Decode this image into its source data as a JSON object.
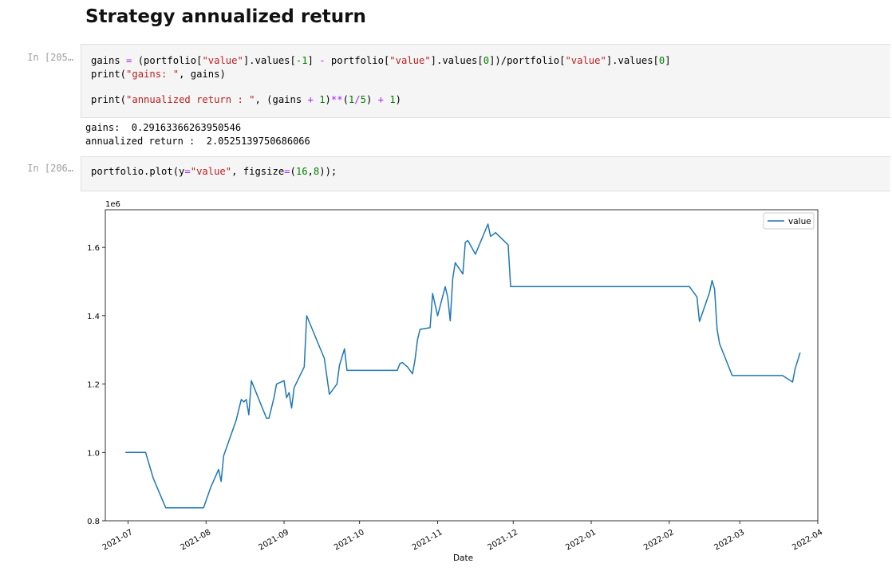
{
  "heading": "Strategy annualized return",
  "cells": [
    {
      "prompt": "In [205…",
      "lines": [
        [
          [
            "gains ",
            ""
          ],
          [
            "=",
            "op"
          ],
          [
            " (portfolio[",
            ""
          ],
          [
            "\"value\"",
            "str"
          ],
          [
            "].values[",
            ""
          ],
          [
            "-1",
            "num"
          ],
          [
            "] ",
            ""
          ],
          [
            "-",
            "op"
          ],
          [
            " portfolio[",
            ""
          ],
          [
            "\"value\"",
            "str"
          ],
          [
            "].values[",
            ""
          ],
          [
            "0",
            "num"
          ],
          [
            "])/portfolio[",
            ""
          ],
          [
            "\"value\"",
            "str"
          ],
          [
            "].values[",
            ""
          ],
          [
            "0",
            "num"
          ],
          [
            "]",
            ""
          ]
        ],
        [
          [
            "print(",
            ""
          ],
          [
            "\"gains: \"",
            "str"
          ],
          [
            ", gains)",
            ""
          ]
        ],
        [],
        [
          [
            "print(",
            ""
          ],
          [
            "\"annualized return : \"",
            "str"
          ],
          [
            ", (gains ",
            ""
          ],
          [
            "+",
            "op"
          ],
          [
            " ",
            ""
          ],
          [
            "1",
            "num"
          ],
          [
            ")",
            ""
          ],
          [
            "**",
            "op"
          ],
          [
            "(",
            ""
          ],
          [
            "1",
            "num"
          ],
          [
            "/",
            "op"
          ],
          [
            "5",
            "num"
          ],
          [
            ") ",
            ""
          ],
          [
            "+",
            "op"
          ],
          [
            " ",
            ""
          ],
          [
            "1",
            "num"
          ],
          [
            ")",
            ""
          ]
        ]
      ],
      "outputs": [
        "gains:  0.29163366263950546",
        "annualized return :  2.0525139750686066"
      ]
    },
    {
      "prompt": "In [206…",
      "lines": [
        [
          [
            "portfolio.plot(y",
            ""
          ],
          [
            "=",
            "op"
          ],
          [
            "\"value\"",
            "str"
          ],
          [
            ", figsize",
            ""
          ],
          [
            "=",
            "op"
          ],
          [
            "(",
            ""
          ],
          [
            "16",
            "num"
          ],
          [
            ",",
            ""
          ],
          [
            "8",
            "num"
          ],
          [
            "));",
            ""
          ]
        ]
      ],
      "outputs": []
    }
  ],
  "chart_data": {
    "type": "line",
    "xlabel": "Date",
    "ylabel": "",
    "scale_label": "1e6",
    "ylim": [
      0.8,
      1.71
    ],
    "xlim": [
      "2021-06-22",
      "2022-04-01"
    ],
    "yticks": [
      0.8,
      1.0,
      1.2,
      1.4,
      1.6
    ],
    "ytick_labels": [
      "0.8",
      "1.0",
      "1.2",
      "1.4",
      "1.6"
    ],
    "xticks": [
      "2021-07-01",
      "2021-08-01",
      "2021-09-01",
      "2021-10-01",
      "2021-11-01",
      "2021-12-01",
      "2022-01-01",
      "2022-02-01",
      "2022-03-01",
      "2022-04-01"
    ],
    "xtick_labels": [
      "2021-07",
      "2021-08",
      "2021-09",
      "2021-10",
      "2021-11",
      "2021-12",
      "2022-01",
      "2022-02",
      "2022-03",
      "2022-04"
    ],
    "legend_position": "upper right",
    "grid": false,
    "series": [
      {
        "name": "value",
        "color": "#1f77b4",
        "points": [
          [
            "2021-06-30",
            1.0
          ],
          [
            "2021-07-08",
            1.0
          ],
          [
            "2021-07-11",
            0.925
          ],
          [
            "2021-07-16",
            0.838
          ],
          [
            "2021-07-31",
            0.838
          ],
          [
            "2021-08-03",
            0.9
          ],
          [
            "2021-08-06",
            0.95
          ],
          [
            "2021-08-07",
            0.915
          ],
          [
            "2021-08-08",
            0.99
          ],
          [
            "2021-08-13",
            1.095
          ],
          [
            "2021-08-15",
            1.155
          ],
          [
            "2021-08-16",
            1.148
          ],
          [
            "2021-08-17",
            1.155
          ],
          [
            "2021-08-18",
            1.11
          ],
          [
            "2021-08-19",
            1.21
          ],
          [
            "2021-08-25",
            1.1
          ],
          [
            "2021-08-26",
            1.1
          ],
          [
            "2021-08-28",
            1.16
          ],
          [
            "2021-08-29",
            1.2
          ],
          [
            "2021-09-01",
            1.21
          ],
          [
            "2021-09-02",
            1.16
          ],
          [
            "2021-09-03",
            1.175
          ],
          [
            "2021-09-04",
            1.13
          ],
          [
            "2021-09-05",
            1.19
          ],
          [
            "2021-09-09",
            1.25
          ],
          [
            "2021-09-10",
            1.4
          ],
          [
            "2021-09-17",
            1.275
          ],
          [
            "2021-09-19",
            1.17
          ],
          [
            "2021-09-22",
            1.2
          ],
          [
            "2021-09-23",
            1.255
          ],
          [
            "2021-09-25",
            1.303
          ],
          [
            "2021-09-26",
            1.24
          ],
          [
            "2021-10-16",
            1.24
          ],
          [
            "2021-10-17",
            1.26
          ],
          [
            "2021-10-18",
            1.263
          ],
          [
            "2021-10-20",
            1.25
          ],
          [
            "2021-10-22",
            1.23
          ],
          [
            "2021-10-23",
            1.27
          ],
          [
            "2021-10-24",
            1.33
          ],
          [
            "2021-10-25",
            1.36
          ],
          [
            "2021-10-29",
            1.365
          ],
          [
            "2021-10-30",
            1.465
          ],
          [
            "2021-11-01",
            1.4
          ],
          [
            "2021-11-04",
            1.485
          ],
          [
            "2021-11-05",
            1.455
          ],
          [
            "2021-11-06",
            1.385
          ],
          [
            "2021-11-07",
            1.51
          ],
          [
            "2021-11-08",
            1.555
          ],
          [
            "2021-11-11",
            1.522
          ],
          [
            "2021-11-12",
            1.615
          ],
          [
            "2021-11-13",
            1.62
          ],
          [
            "2021-11-16",
            1.58
          ],
          [
            "2021-11-21",
            1.668
          ],
          [
            "2021-11-22",
            1.632
          ],
          [
            "2021-11-24",
            1.643
          ],
          [
            "2021-11-29",
            1.607
          ],
          [
            "2021-11-30",
            1.485
          ],
          [
            "2022-02-09",
            1.485
          ],
          [
            "2022-02-12",
            1.455
          ],
          [
            "2022-02-13",
            1.383
          ],
          [
            "2022-02-17",
            1.468
          ],
          [
            "2022-02-18",
            1.503
          ],
          [
            "2022-02-19",
            1.478
          ],
          [
            "2022-02-20",
            1.36
          ],
          [
            "2022-02-21",
            1.318
          ],
          [
            "2022-02-26",
            1.225
          ],
          [
            "2022-03-18",
            1.225
          ],
          [
            "2022-03-22",
            1.206
          ],
          [
            "2022-03-23",
            1.245
          ],
          [
            "2022-03-25",
            1.292
          ]
        ]
      }
    ]
  }
}
